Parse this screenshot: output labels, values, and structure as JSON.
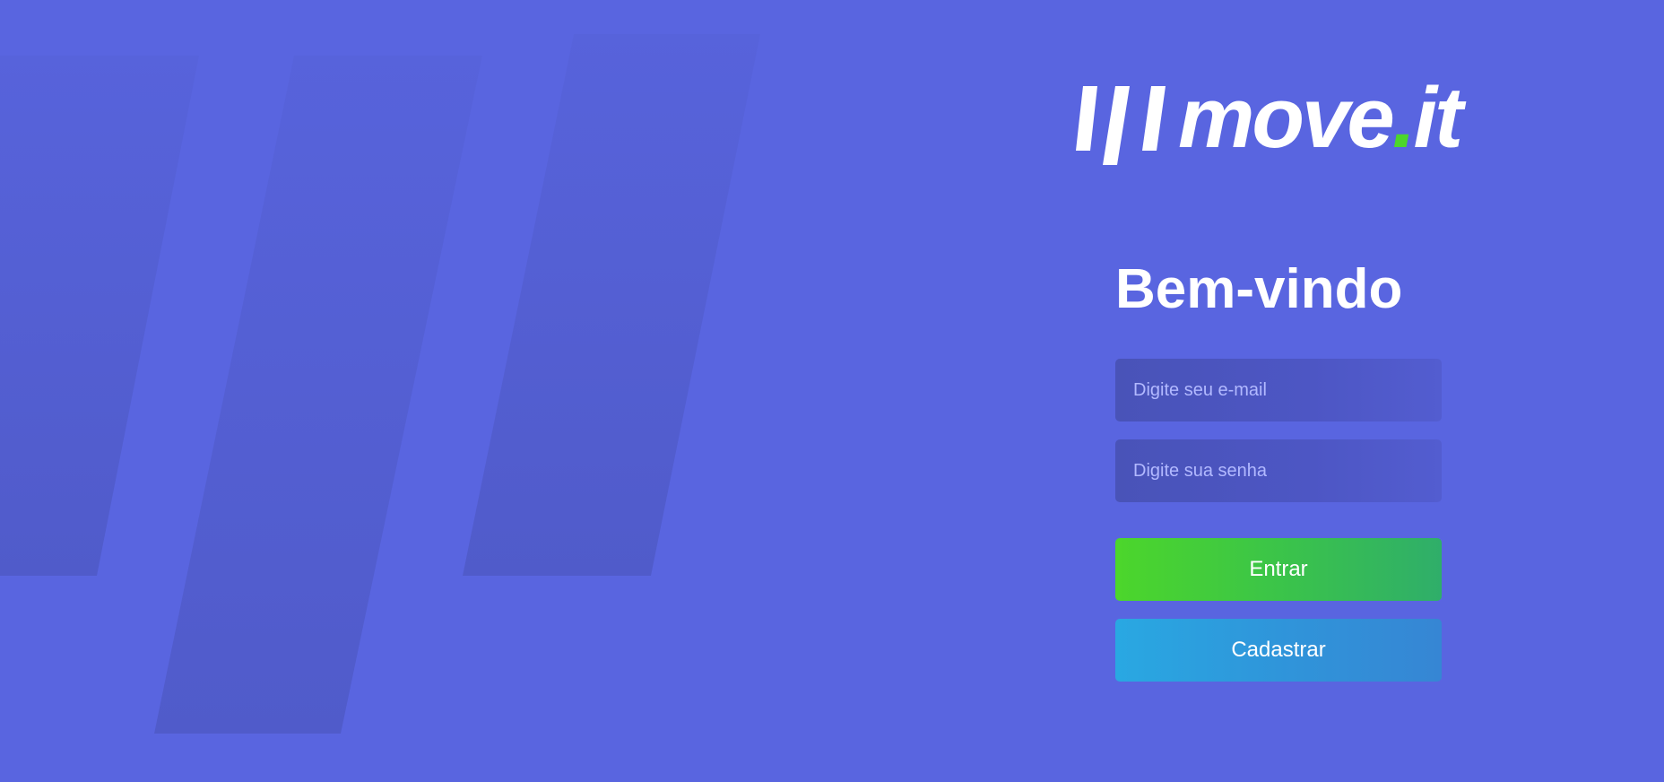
{
  "app": {
    "brand": {
      "logo_word": "move",
      "logo_dot": ".",
      "logo_suffix": "it",
      "logo_icon": "triple-slash-logo-icon"
    }
  },
  "login": {
    "title": "Bem-vindo",
    "email": {
      "placeholder": "Digite seu e-mail",
      "value": ""
    },
    "password": {
      "placeholder": "Digite sua senha",
      "value": ""
    },
    "login_button_label": "Entrar",
    "signup_button_label": "Cadastrar"
  },
  "colors": {
    "background": "#5965E0",
    "accent_green": "#4CD62B",
    "accent_blue": "#29A8E2",
    "input_background": "#4953B8",
    "placeholder": "#B2B9FF"
  }
}
